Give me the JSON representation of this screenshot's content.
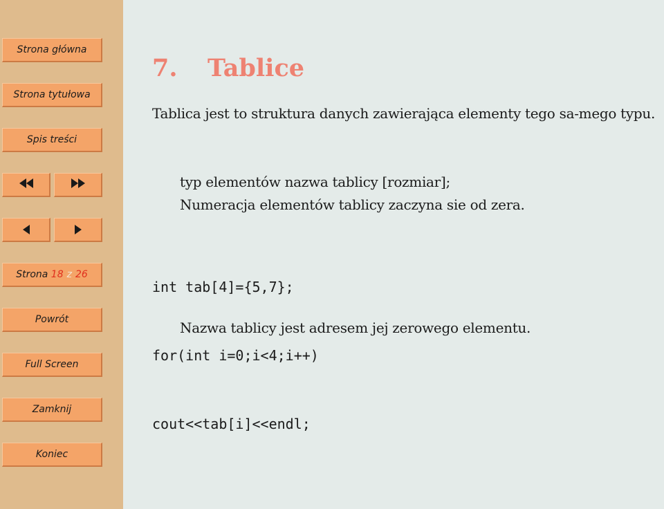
{
  "sidebar": {
    "home": "Strona główna",
    "title_page": "Strona tytułowa",
    "toc": "Spis treści",
    "nav_icons": {
      "first": "double-left-triangle",
      "last": "double-right-triangle",
      "prev": "left-triangle",
      "next": "right-triangle"
    },
    "page_indicator": {
      "label": "Strona",
      "current": "18",
      "separator": "z",
      "total": "26"
    },
    "back": "Powrót",
    "full_screen": "Full Screen",
    "close": "Zamknij",
    "quit": "Koniec"
  },
  "content": {
    "section_number": "7.",
    "section_title": "Tablice",
    "intro": "Tablica jest to struktura danych zawierająca elementy tego sa-mego typu.",
    "declaration_lines": [
      "typ elementów nazwa tablicy [rozmiar];",
      "Numeracja elementów tablicy zaczyna sie od zera."
    ],
    "code_lines": [
      "int tab[4]={5,7};",
      "for(int i=0;i<4;i++)",
      "cout<<tab[i]<<endl;"
    ],
    "note": "Nazwa tablicy jest adresem jej zerowego elementu."
  },
  "colors": {
    "sidebar_bg": "#dfbb8d",
    "button_bg": "#f4a468",
    "title": "#ee8272",
    "page_number": "#e0301e",
    "content_bg": "#e4ebe9"
  }
}
